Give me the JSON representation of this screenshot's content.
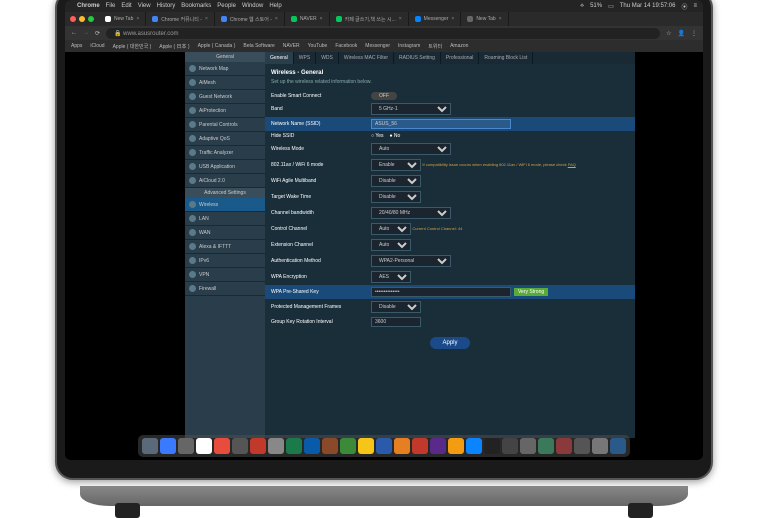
{
  "menubar": {
    "app": "Chrome",
    "items": [
      "File",
      "Edit",
      "View",
      "History",
      "Bookmarks",
      "People",
      "Window",
      "Help"
    ],
    "battery": "51%",
    "clock": "Thu Mar 14  19:57:06"
  },
  "tabs": [
    {
      "fav": "#fff",
      "title": "New Tab"
    },
    {
      "fav": "#4285f4",
      "title": "Chrome 커뮤니티 - "
    },
    {
      "fav": "#4285f4",
      "title": "Chrome 웹 스토어 -"
    },
    {
      "fav": "#03c75a",
      "title": "NAVER"
    },
    {
      "fav": "#03c75a",
      "title": "카페 글쓰기,책 쓰는 시..."
    },
    {
      "fav": "#0084ff",
      "title": "Messenger"
    },
    {
      "fav": "#666",
      "title": "New Tab"
    }
  ],
  "url": "www.asusrouter.com",
  "bookmarks": [
    "Apps",
    "iCloud",
    "Apple ( 대한민국 )",
    "Apple ( 日本 )",
    "Apple ( Canada )",
    "Beta Software",
    "NAVER",
    "YouTube",
    "Facebook",
    "Messenger",
    "Instagram",
    "트위터",
    "Amazon"
  ],
  "sidebar": {
    "general_head": "General",
    "general": [
      "Network Map",
      "AiMesh",
      "Guest Network",
      "AiProtection",
      "Parental Controls",
      "Adaptive QoS",
      "Traffic Analyzer",
      "USB Application",
      "AiCloud 2.0"
    ],
    "adv_head": "Advanced Settings",
    "adv": [
      "Wireless",
      "LAN",
      "WAN",
      "Alexa & IFTTT",
      "IPv6",
      "VPN",
      "Firewall"
    ]
  },
  "maintabs": [
    "General",
    "WPS",
    "WDS",
    "Wireless MAC Filter",
    "RADIUS Setting",
    "Professional",
    "Roaming Block List"
  ],
  "panel": {
    "title": "Wireless - General",
    "sub": "Set up the wireless related information below.",
    "smart_label": "Enable Smart Connect",
    "smart_val": "OFF",
    "band_label": "Band",
    "band_val": "5 GHz-1",
    "ssid_label": "Network Name (SSID)",
    "ssid_val": "ASUS_56",
    "hide_label": "Hide SSID",
    "hide_yes": "Yes",
    "hide_no": "No",
    "mode_label": "Wireless Mode",
    "mode_val": "Auto",
    "ax_label": "802.11ax / WiFi 6 mode",
    "ax_val": "Enable",
    "ax_warn": "If compatibility issue occurs when enabling 802.11ax / WiFi 6 mode, please check ",
    "ax_link": "FAQ",
    "agile_label": "WiFi Agile Multiband",
    "agile_val": "Disable",
    "twt_label": "Target Wake Time",
    "twt_val": "Disable",
    "bw_label": "Channel bandwidth",
    "bw_val": "20/40/80 MHz",
    "ch_label": "Control Channel",
    "ch_val": "Auto",
    "ch_note": "Current Control Channel: 44",
    "ext_label": "Extension Channel",
    "ext_val": "Auto",
    "auth_label": "Authentication Method",
    "auth_val": "WPA2-Personal",
    "enc_label": "WPA Encryption",
    "enc_val": "AES",
    "psk_label": "WPA Pre-Shared Key",
    "psk_val": "••••••••••••••",
    "psk_btn": "Very Strong",
    "pmf_label": "Protected Management Frames",
    "pmf_val": "Disable",
    "gkey_label": "Group Key Rotation Interval",
    "gkey_val": "3600",
    "apply": "Apply"
  },
  "dock_colors": [
    "#5a6a7a",
    "#3a7aff",
    "#666",
    "#fff",
    "#e74c3c",
    "#555",
    "#c0392b",
    "#888",
    "#1a7a4a",
    "#0a5aaa",
    "#8a4a2a",
    "#3a8a3a",
    "#f5c518",
    "#2a5aaa",
    "#e67e22",
    "#c0392b",
    "#5a2a8a",
    "#f39c12",
    "#0a84ff",
    "#222",
    "#444",
    "#666",
    "#3a7a5a",
    "#8a3a3a",
    "#555",
    "#777",
    "#2a5a8a"
  ]
}
